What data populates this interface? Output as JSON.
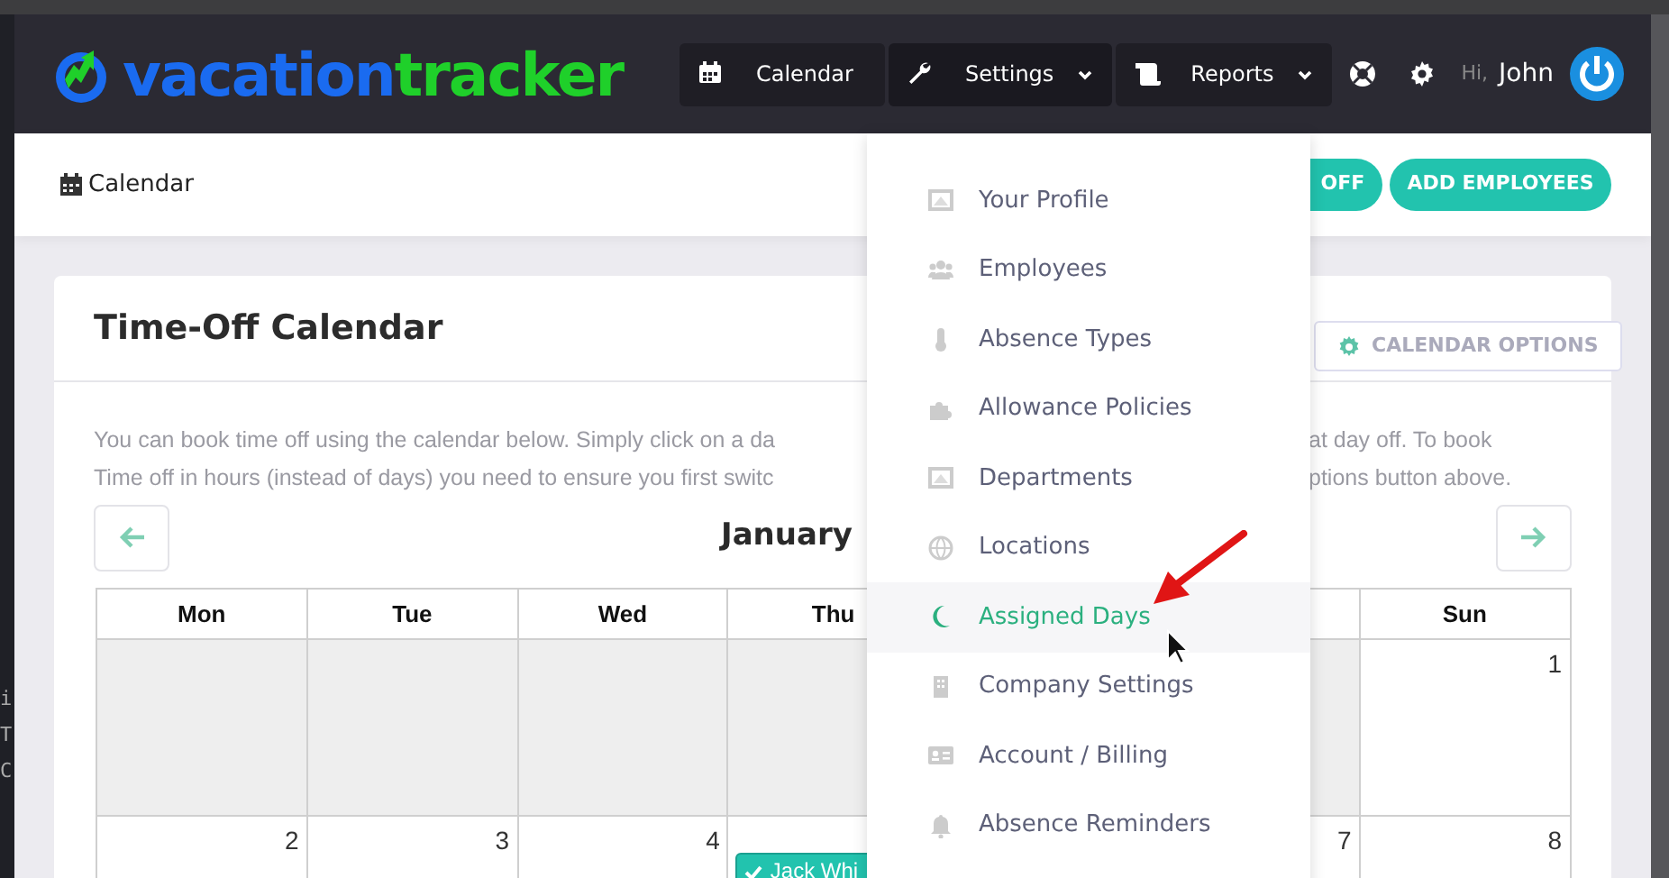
{
  "background_text": [
    "i",
    "T",
    "C"
  ],
  "navbar": {
    "logo": {
      "part_1": "vacation",
      "part_2": "tracker"
    },
    "menu": [
      {
        "label": "Calendar",
        "dropdown": false,
        "open": false
      },
      {
        "label": "Settings",
        "dropdown": true,
        "open": true
      },
      {
        "label": "Reports",
        "dropdown": true,
        "open": false
      }
    ],
    "greeting": "Hi,",
    "user": "John"
  },
  "subheader": {
    "breadcrumb": "Calendar",
    "buttons": [
      "OFF",
      "ADD EMPLOYEES"
    ]
  },
  "card": {
    "title": "Time-Off Calendar",
    "options_button": "CALENDAR OPTIONS",
    "intro_lines": [
      {
        "left": "You can book time off using the calendar below. Simply click on a da",
        "right": "at day off. To book"
      },
      {
        "left": "Time off in hours (instead of days) you need to ensure you first switc",
        "right": "ptions button above."
      }
    ],
    "month": "January",
    "columns": {
      "mon": "Mon",
      "tue": "Tue",
      "wed": "Wed",
      "thu": "Thu",
      "sun": "Sun"
    },
    "weeks": [
      {
        "mon": {
          "other_month": true
        },
        "tue": {
          "other_month": true
        },
        "wed": {
          "other_month": true
        },
        "thu": {
          "other_month": true
        },
        "sat": {
          "other_month": true
        },
        "sun": {
          "other_month": false,
          "day": "1"
        }
      },
      {
        "mon": {
          "other_month": false,
          "day": "2"
        },
        "tue": {
          "other_month": false,
          "day": "3"
        },
        "wed": {
          "other_month": false,
          "day": "4"
        },
        "thu": {
          "other_month": false,
          "events": [
            {
              "title": "Jack Whi"
            }
          ]
        },
        "sat": {
          "other_month": false,
          "day": "7"
        },
        "sun": {
          "other_month": false,
          "day": "8"
        }
      }
    ]
  },
  "settings_menu": [
    {
      "label": "Your Profile",
      "selected": false
    },
    {
      "label": "Employees",
      "selected": false
    },
    {
      "label": "Absence Types",
      "selected": false
    },
    {
      "label": "Allowance Policies",
      "selected": false
    },
    {
      "label": "Departments",
      "selected": false
    },
    {
      "label": "Locations",
      "selected": false
    },
    {
      "label": "Assigned Days",
      "selected": true
    },
    {
      "label": "Company Settings",
      "selected": false
    },
    {
      "label": "Account / Billing",
      "selected": false
    },
    {
      "label": "Absence Reminders",
      "selected": false
    }
  ]
}
